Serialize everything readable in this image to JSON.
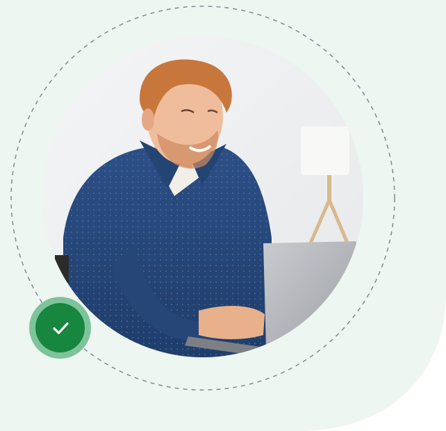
{
  "colors": {
    "background_blob": "#eef6f1",
    "dashed_ring": "#7d8a97",
    "badge_outer": "#7fc39a",
    "badge_inner": "#17863f",
    "check_mark": "#ffffff"
  },
  "icons": {
    "badge": "check-icon"
  },
  "photo": {
    "subject": "smiling-man-using-laptop"
  }
}
